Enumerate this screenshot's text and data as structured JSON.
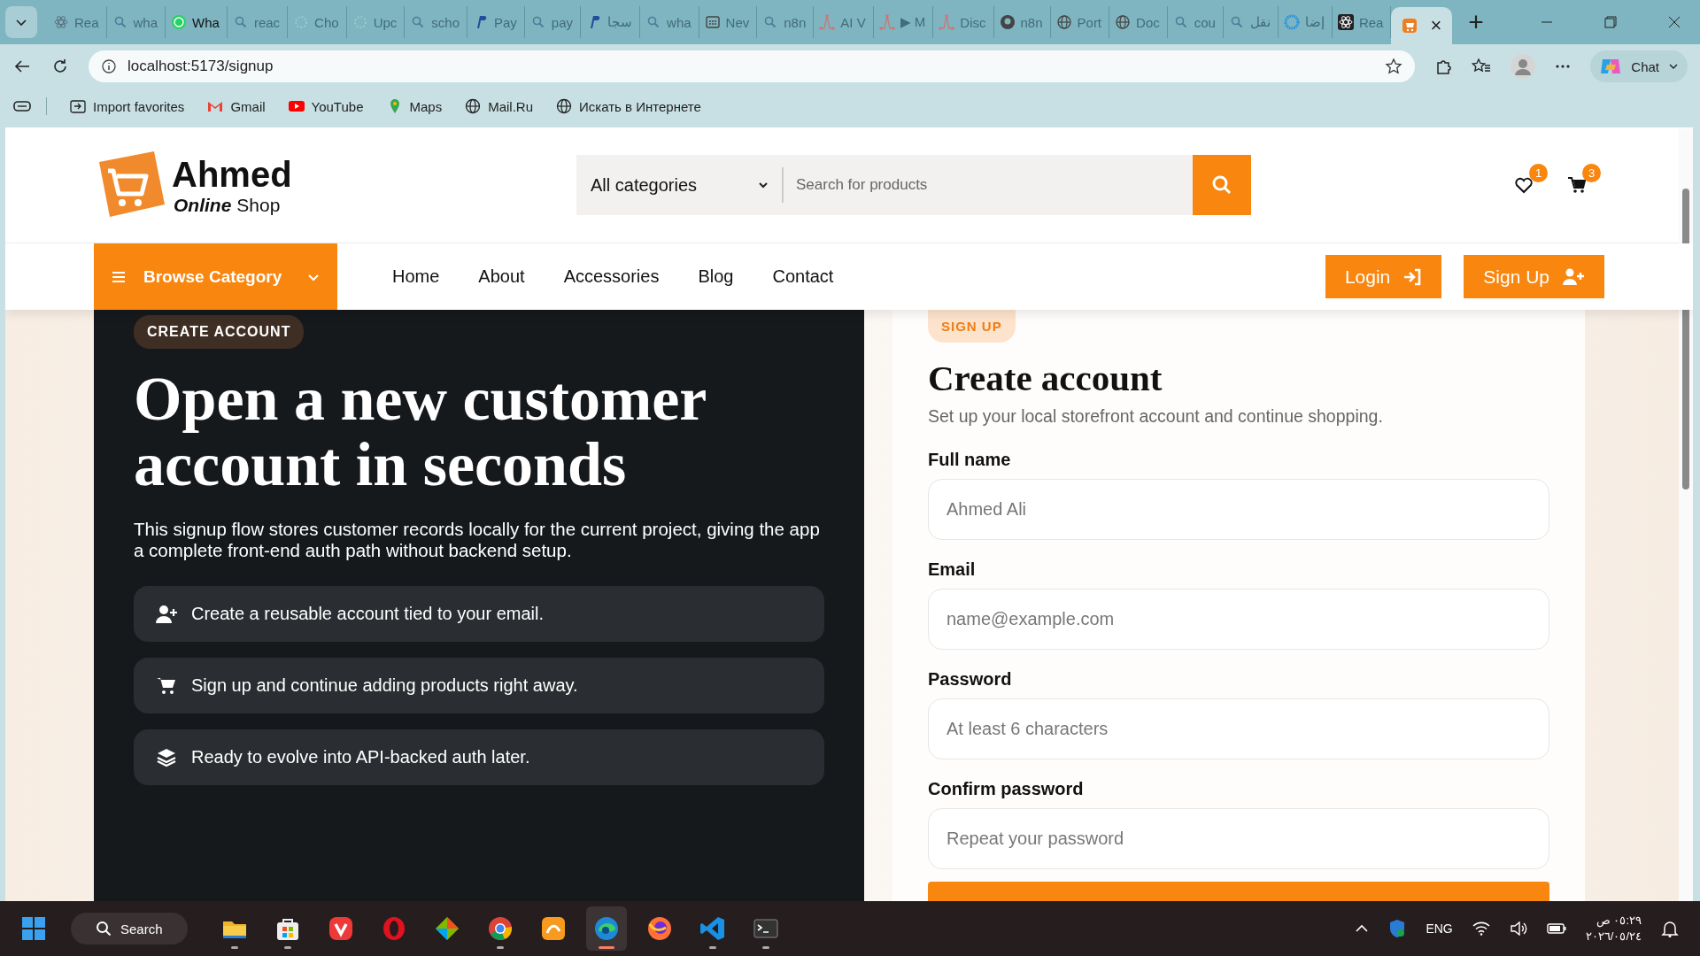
{
  "browser": {
    "tabs": [
      {
        "kind": "react",
        "title": "Rea",
        "selected": false
      },
      {
        "kind": "search",
        "title": "wha",
        "selected": false
      },
      {
        "kind": "whatsapp",
        "title": "Wha",
        "selected": false
      },
      {
        "kind": "search",
        "title": "reac",
        "selected": false
      },
      {
        "kind": "spinner",
        "title": "Cho",
        "selected": false
      },
      {
        "kind": "spinner",
        "title": "Upc",
        "selected": false
      },
      {
        "kind": "search",
        "title": "scho",
        "selected": false
      },
      {
        "kind": "paypal",
        "title": "Pay",
        "selected": false
      },
      {
        "kind": "search",
        "title": "pay",
        "selected": false
      },
      {
        "kind": "paypal",
        "title": "سجا",
        "selected": false
      },
      {
        "kind": "search",
        "title": "wha",
        "selected": false
      },
      {
        "kind": "news",
        "title": "Nev",
        "selected": false
      },
      {
        "kind": "search",
        "title": "n8n",
        "selected": false
      },
      {
        "kind": "flow",
        "title": "AI V",
        "selected": false
      },
      {
        "kind": "flow",
        "title": "▶ M",
        "selected": false
      },
      {
        "kind": "flow",
        "title": "Disc",
        "selected": false
      },
      {
        "kind": "github",
        "title": "n8n",
        "selected": false
      },
      {
        "kind": "globe",
        "title": "Port",
        "selected": false
      },
      {
        "kind": "globe",
        "title": "Doc",
        "selected": false
      },
      {
        "kind": "search",
        "title": "cou",
        "selected": false
      },
      {
        "kind": "search",
        "title": "نقل",
        "selected": false
      },
      {
        "kind": "ring",
        "title": "إضا",
        "selected": false
      },
      {
        "kind": "react-dark",
        "title": "Rea",
        "selected": false
      },
      {
        "kind": "shop",
        "selected": true
      }
    ],
    "close_tab": "×",
    "new_tab": "+",
    "address": "localhost:5173/signup",
    "chat": "Chat",
    "bookmarks": [
      {
        "kind": "import",
        "label": "Import favorites"
      },
      {
        "kind": "gmail",
        "label": "Gmail"
      },
      {
        "kind": "youtube",
        "label": "YouTube"
      },
      {
        "kind": "maps",
        "label": "Maps"
      },
      {
        "kind": "globe",
        "label": "Mail.Ru"
      },
      {
        "kind": "globe",
        "label": "Искать в Интернете"
      }
    ]
  },
  "site": {
    "logo": {
      "name": "Ahmed",
      "sub_bold": "Online",
      "sub": "Shop"
    },
    "search": {
      "category": "All categories",
      "placeholder": "Search for products"
    },
    "wishlist_count": "1",
    "cart_count": "3",
    "browse": "Browse Category",
    "nav": [
      "Home",
      "About",
      "Accessories",
      "Blog",
      "Contact"
    ],
    "login": "Login",
    "signup": "Sign Up"
  },
  "hero": {
    "badge": "CREATE ACCOUNT",
    "title": "Open a new customer account in seconds",
    "text": "This signup flow stores customer records locally for the current project, giving the app a complete front-end auth path without backend setup.",
    "features": [
      {
        "kind": "user-plus",
        "text": "Create a reusable account tied to your email."
      },
      {
        "kind": "cart",
        "text": "Sign up and continue adding products right away."
      },
      {
        "kind": "layers",
        "text": "Ready to evolve into API-backed auth later."
      }
    ]
  },
  "form": {
    "badge": "SIGN UP",
    "title": "Create account",
    "subtitle": "Set up your local storefront account and continue shopping.",
    "fields": [
      {
        "label": "Full name",
        "placeholder": "Ahmed Ali"
      },
      {
        "label": "Email",
        "placeholder": "name@example.com"
      },
      {
        "label": "Password",
        "placeholder": "At least 6 characters"
      },
      {
        "label": "Confirm password",
        "placeholder": "Repeat your password"
      }
    ]
  },
  "taskbar": {
    "search": "Search",
    "apps": [
      {
        "kind": "files",
        "running": true,
        "selected": false
      },
      {
        "kind": "store",
        "running": true,
        "selected": false
      },
      {
        "kind": "vivaldi",
        "running": false,
        "selected": false
      },
      {
        "kind": "opera",
        "running": false,
        "selected": false
      },
      {
        "kind": "git",
        "running": false,
        "selected": false
      },
      {
        "kind": "chrome",
        "running": true,
        "selected": false
      },
      {
        "kind": "uc",
        "running": false,
        "selected": false
      },
      {
        "kind": "edge",
        "running": true,
        "selected": true
      },
      {
        "kind": "firefox",
        "running": false,
        "selected": false
      },
      {
        "kind": "vscode",
        "running": true,
        "selected": false
      },
      {
        "kind": "terminal",
        "running": true,
        "selected": false
      }
    ],
    "language": "ENG",
    "time": "٠٥:٢٩ ص",
    "date": "٢٠٢٦/٠٥/٢٤"
  }
}
